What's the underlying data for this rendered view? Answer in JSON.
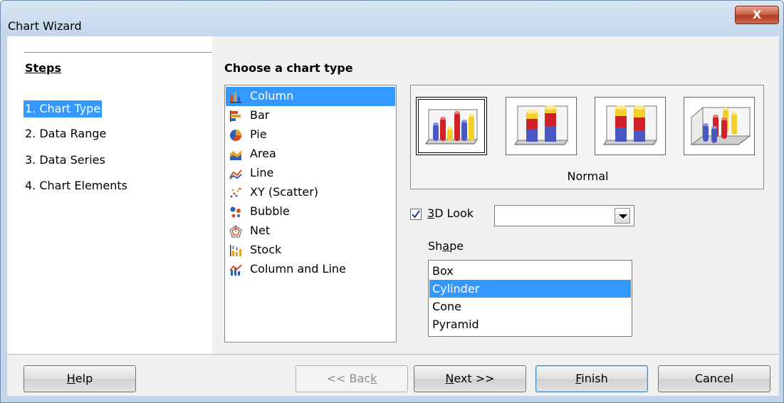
{
  "window": {
    "title": "Chart Wizard",
    "close_label": "X"
  },
  "steps": {
    "title": "Steps",
    "items": [
      {
        "label": "1. Chart Type",
        "selected": true
      },
      {
        "label": "2. Data Range",
        "selected": false
      },
      {
        "label": "3. Data Series",
        "selected": false
      },
      {
        "label": "4. Chart Elements",
        "selected": false
      }
    ]
  },
  "chart_type": {
    "title": "Choose a chart type",
    "items": [
      {
        "label": "Column",
        "icon": "column-chart-icon",
        "selected": true
      },
      {
        "label": "Bar",
        "icon": "bar-chart-icon",
        "selected": false
      },
      {
        "label": "Pie",
        "icon": "pie-chart-icon",
        "selected": false
      },
      {
        "label": "Area",
        "icon": "area-chart-icon",
        "selected": false
      },
      {
        "label": "Line",
        "icon": "line-chart-icon",
        "selected": false
      },
      {
        "label": "XY (Scatter)",
        "icon": "scatter-chart-icon",
        "selected": false
      },
      {
        "label": "Bubble",
        "icon": "bubble-chart-icon",
        "selected": false
      },
      {
        "label": "Net",
        "icon": "net-chart-icon",
        "selected": false
      },
      {
        "label": "Stock",
        "icon": "stock-chart-icon",
        "selected": false
      },
      {
        "label": "Column and Line",
        "icon": "column-line-chart-icon",
        "selected": false
      }
    ]
  },
  "variants": {
    "items": [
      {
        "name": "normal-variant-icon",
        "selected": true
      },
      {
        "name": "stacked-variant-icon",
        "selected": false
      },
      {
        "name": "percent-stacked-variant-icon",
        "selected": false
      },
      {
        "name": "deep-variant-icon",
        "selected": false
      }
    ],
    "selected_name": "Normal"
  },
  "options": {
    "look3d_label": "3D Look",
    "look3d_checked": true,
    "look_value": "",
    "shape_label": "Shape",
    "shapes": [
      {
        "label": "Box",
        "selected": false
      },
      {
        "label": "Cylinder",
        "selected": true
      },
      {
        "label": "Cone",
        "selected": false
      },
      {
        "label": "Pyramid",
        "selected": false
      }
    ]
  },
  "buttons": {
    "help": "Help",
    "back": "<< Back",
    "next": "Next >>",
    "finish": "Finish",
    "cancel": "Cancel"
  },
  "colors": {
    "selection": "#3399ff",
    "bar_red": "#d0202a",
    "bar_blue": "#4a58c4",
    "bar_yellow": "#f2cf2a"
  }
}
